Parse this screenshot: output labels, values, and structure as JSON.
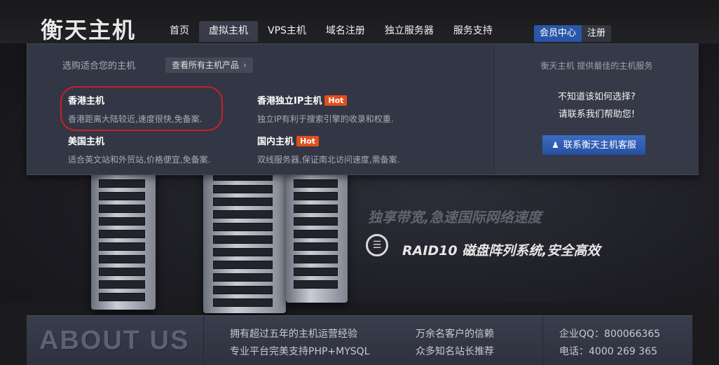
{
  "logo": "衡天主机",
  "nav": {
    "items": [
      "首页",
      "虚拟主机",
      "VPS主机",
      "域名注册",
      "独立服务器",
      "服务支持"
    ],
    "active": 1
  },
  "auth": {
    "member": "会员中心",
    "register": "注册"
  },
  "dropdown": {
    "heading": "选购适合您的主机",
    "view_all": "查看所有主机产品",
    "products": [
      {
        "name": "香港主机",
        "desc": "香港距离大陆较近,速度很快,免备案.",
        "hot": ""
      },
      {
        "name": "香港独立IP主机",
        "desc": "独立IP有利于搜索引擎的收录和权重.",
        "hot": "Hot"
      },
      {
        "name": "美国主机",
        "desc": "适合英文站和外贸站,价格便宜,免备案.",
        "hot": ""
      },
      {
        "name": "国内主机",
        "desc": "双线服务器,保证南北访问速度,需备案.",
        "hot": "Hot"
      }
    ],
    "tagline": "衡天主机 提供最佳的主机服务",
    "help_line1": "不知道该如何选择?",
    "help_line2": "请联系我们帮助您!",
    "contact_button": "联系衡天主机客服"
  },
  "hero": {
    "line1": "独享带宽,急速国际网络速度",
    "line2": "RAID10 磁盘阵列系统,安全高效",
    "slides": 3,
    "active_slide": 3
  },
  "about": {
    "title": "ABOUT US",
    "col1": [
      "拥有超过五年的主机运营经验",
      "专业平台完美支持PHP+MYSQL"
    ],
    "col2": [
      "万余名客户的信赖",
      "众多知名站长推荐"
    ],
    "col3": [
      "企业QQ：800066365",
      "电话：4000 269 365"
    ]
  },
  "colors": {
    "accent_blue": "#2a57a8",
    "hot_badge": "#e0501c",
    "highlight_ring": "#c9202a"
  }
}
